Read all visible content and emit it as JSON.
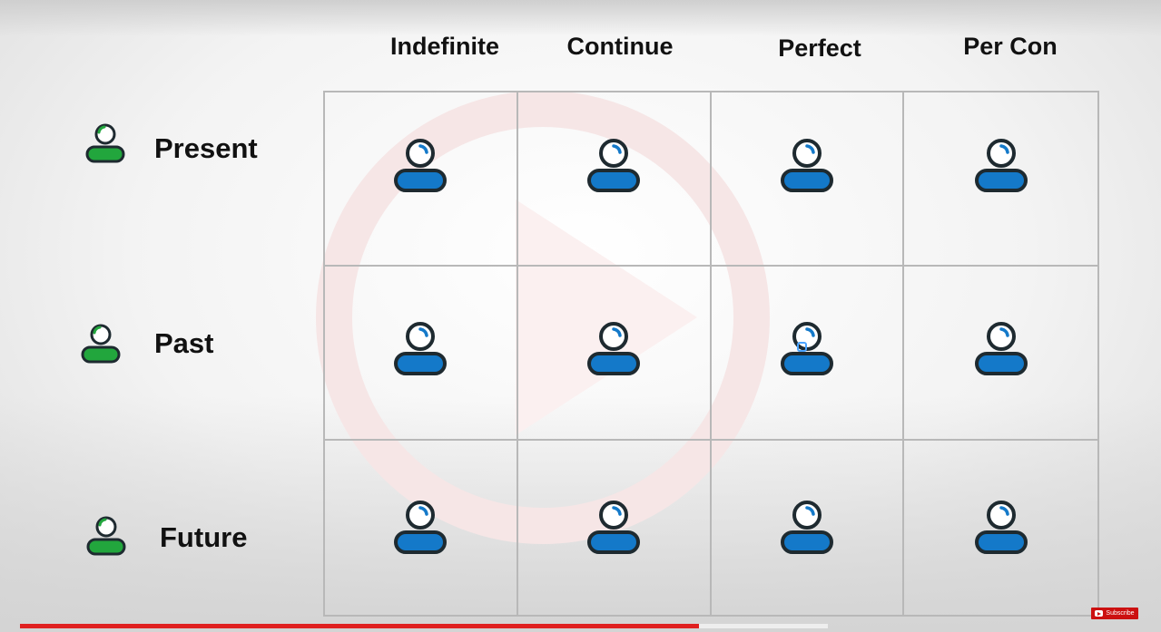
{
  "columns": [
    "Indefinite",
    "Continue",
    "Perfect",
    "Per Con"
  ],
  "rows": [
    "Present",
    "Past",
    "Future"
  ],
  "colors": {
    "person_blue": "#1479c9",
    "person_green": "#22a63d",
    "outline": "#1e2a30",
    "progress": "#e02020"
  },
  "icons": {
    "row": "person-icon",
    "cell": "person-icon"
  },
  "video": {
    "progress_fraction": 0.84,
    "subscribe_label": "Subscribe"
  }
}
